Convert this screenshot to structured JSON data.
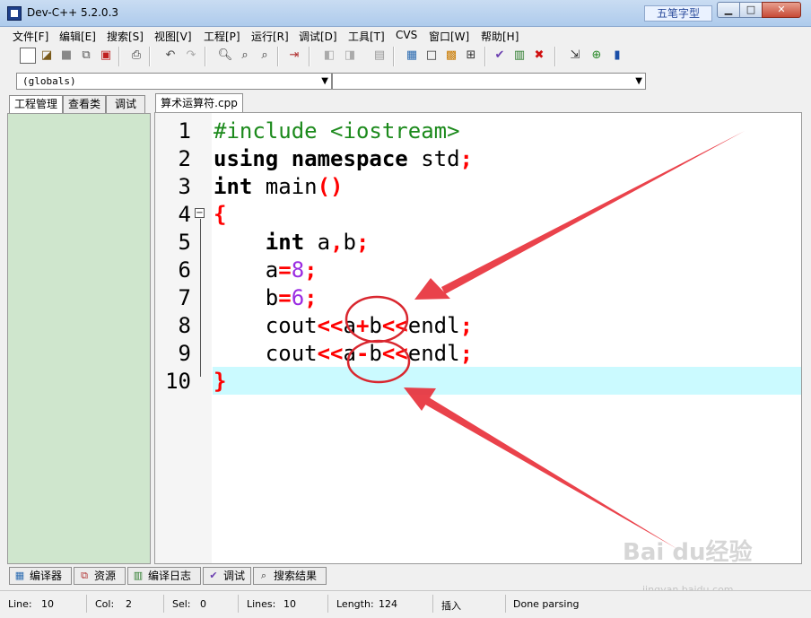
{
  "window": {
    "title": "Dev-C++ 5.2.0.3",
    "ime_badge": "五笔字型",
    "minimize_label": "▁",
    "maximize_label": "□",
    "close_label": "✕"
  },
  "menu": [
    "文件[F]",
    "编辑[E]",
    "搜索[S]",
    "视图[V]",
    "工程[P]",
    "运行[R]",
    "调试[D]",
    "工具[T]",
    "CVS",
    "窗口[W]",
    "帮助[H]"
  ],
  "combos": {
    "scope": "(globals)",
    "members": ""
  },
  "left_tabs": [
    "工程管理",
    "查看类",
    "调试"
  ],
  "editor": {
    "file_tab": "算术运算符.cpp",
    "line_numbers": [
      "1",
      "2",
      "3",
      "4",
      "5",
      "6",
      "7",
      "8",
      "9",
      "10"
    ],
    "highlighted_line": 10
  },
  "bottom_tabs": [
    "编译器",
    "资源",
    "编译日志",
    "调试",
    "搜索结果"
  ],
  "status": {
    "line_label": "Line:",
    "line_value": "10",
    "col_label": "Col:",
    "col_value": "2",
    "sel_label": "Sel:",
    "sel_value": "0",
    "lines_label": "Lines:",
    "lines_value": "10",
    "length_label": "Length:",
    "length_value": "124",
    "mode": "插入",
    "message": "Done parsing"
  },
  "watermark": {
    "text": "Bai du经验",
    "sub": "jingyan.baidu.com"
  },
  "colors": {
    "highlight": "#cbfaff",
    "project_tree": "#cfe6cd",
    "annotation": "#e8323c"
  }
}
